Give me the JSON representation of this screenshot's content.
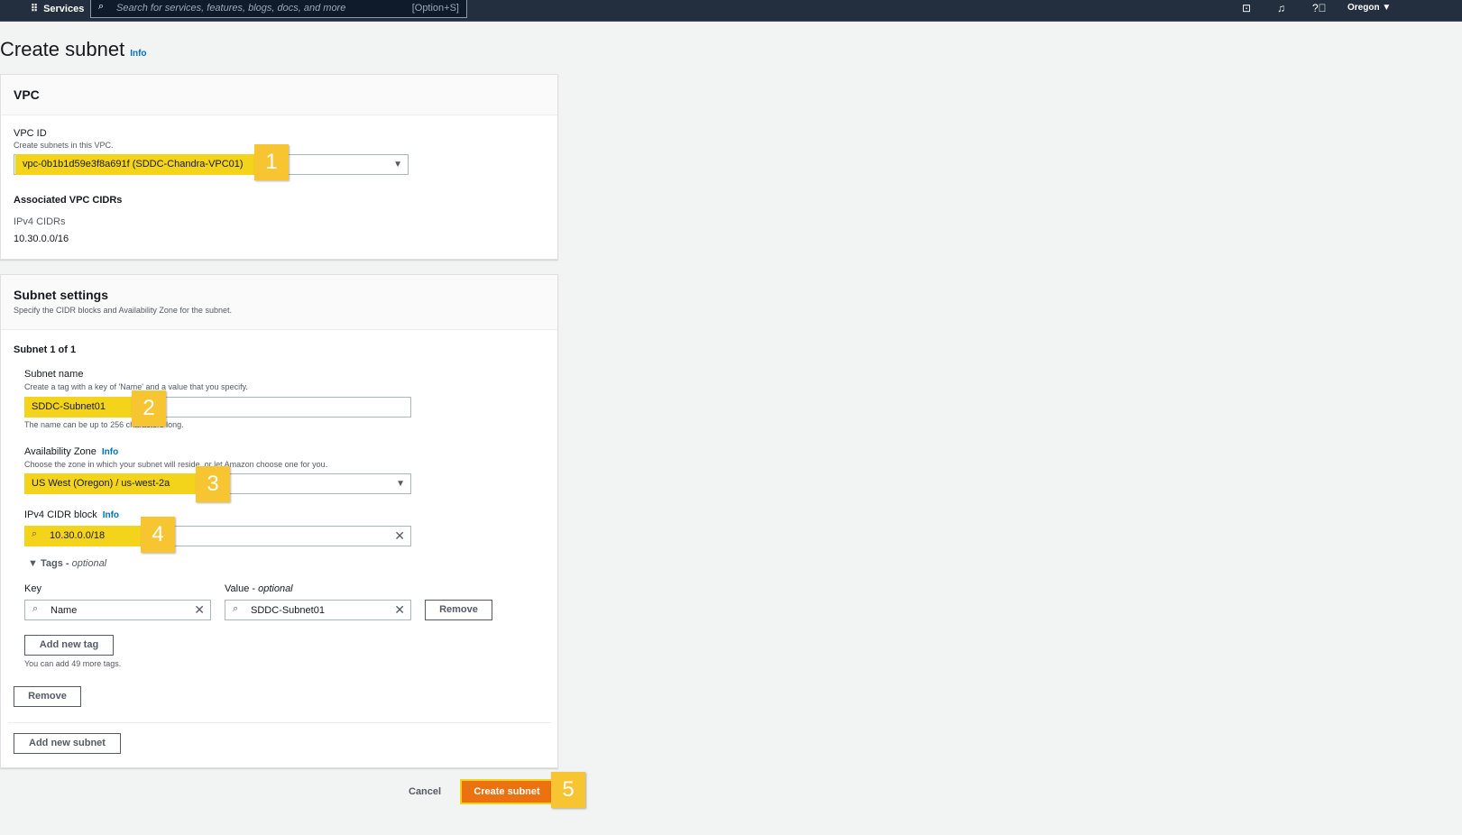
{
  "nav": {
    "services": "Services",
    "search_placeholder": "Search for services, features, blogs, docs, and more",
    "shortcut": "[Option+S]",
    "region": "Oregon ▼"
  },
  "page": {
    "title": "Create subnet",
    "info": "Info"
  },
  "vpc": {
    "header": "VPC",
    "vpc_id_label": "VPC ID",
    "vpc_id_desc": "Create subnets in this VPC.",
    "vpc_id_value": "vpc-0b1b1d59e3f8a691f (SDDC-Chandra-VPC01)",
    "assoc_title": "Associated VPC CIDRs",
    "ipv4_label": "IPv4 CIDRs",
    "ipv4_value": "10.30.0.0/16"
  },
  "subnet": {
    "header": "Subnet settings",
    "header_desc": "Specify the CIDR blocks and Availability Zone for the subnet.",
    "count": "Subnet 1 of 1",
    "name_label": "Subnet name",
    "name_desc": "Create a tag with a key of 'Name' and a value that you specify.",
    "name_value": "SDDC-Subnet01",
    "name_hint": "The name can be up to 256 characters long.",
    "az_label": "Availability Zone",
    "az_info": "Info",
    "az_desc": "Choose the zone in which your subnet will reside, or let Amazon choose one for you.",
    "az_value": "US West (Oregon) / us-west-2a",
    "cidr_label": "IPv4 CIDR block",
    "cidr_info": "Info",
    "cidr_value": "10.30.0.0/18",
    "tags_label": "Tags - ",
    "tags_optional": "optional",
    "key_label": "Key",
    "value_label": "Value - ",
    "value_optional": "optional",
    "key_value": "Name",
    "tag_value": "SDDC-Subnet01",
    "remove_tag": "Remove",
    "add_tag": "Add new tag",
    "tag_hint": "You can add 49 more tags.",
    "remove_subnet": "Remove",
    "add_subnet": "Add new subnet"
  },
  "footer": {
    "cancel": "Cancel",
    "create": "Create subnet"
  },
  "badges": [
    "1",
    "2",
    "3",
    "4",
    "5"
  ],
  "colors": {
    "highlight": "#f4d41b",
    "badge": "#f8c532",
    "primary": "#ec7211",
    "nav": "#232f3e"
  }
}
